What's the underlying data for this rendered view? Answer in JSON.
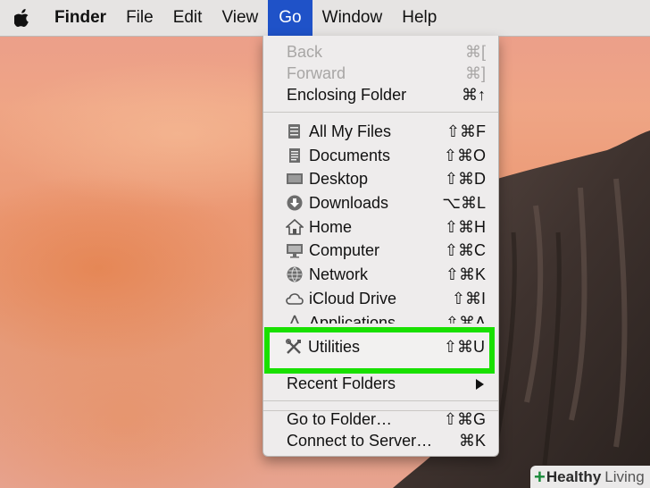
{
  "menubar": {
    "apple_icon": "apple-icon",
    "items": [
      {
        "label": "Finder"
      },
      {
        "label": "File"
      },
      {
        "label": "Edit"
      },
      {
        "label": "View"
      },
      {
        "label": "Go"
      },
      {
        "label": "Window"
      },
      {
        "label": "Help"
      }
    ]
  },
  "go_menu": {
    "nav": [
      {
        "label": "Back",
        "shortcut": "⌘[",
        "enabled": false
      },
      {
        "label": "Forward",
        "shortcut": "⌘]",
        "enabled": false
      },
      {
        "label": "Enclosing Folder",
        "shortcut": "⌘↑",
        "enabled": true
      }
    ],
    "places": [
      {
        "label": "All My Files",
        "shortcut": "⇧⌘F",
        "icon": "all-files-icon"
      },
      {
        "label": "Documents",
        "shortcut": "⇧⌘O",
        "icon": "documents-icon"
      },
      {
        "label": "Desktop",
        "shortcut": "⇧⌘D",
        "icon": "desktop-icon"
      },
      {
        "label": "Downloads",
        "shortcut": "⌥⌘L",
        "icon": "downloads-icon"
      },
      {
        "label": "Home",
        "shortcut": "⇧⌘H",
        "icon": "home-icon"
      },
      {
        "label": "Computer",
        "shortcut": "⇧⌘C",
        "icon": "computer-icon"
      },
      {
        "label": "Network",
        "shortcut": "⇧⌘K",
        "icon": "network-icon"
      },
      {
        "label": "iCloud Drive",
        "shortcut": "⇧⌘I",
        "icon": "cloud-icon"
      },
      {
        "label": "Applications",
        "shortcut": "⇧⌘A",
        "icon": "applications-icon"
      },
      {
        "label": "Utilities",
        "shortcut": "⇧⌘U",
        "icon": "utilities-icon"
      }
    ],
    "recent": {
      "label": "Recent Folders"
    },
    "folder": [
      {
        "label": "Go to Folder…",
        "shortcut": "⇧⌘G"
      },
      {
        "label": "Connect to Server…",
        "shortcut": "⌘K"
      }
    ],
    "highlight_color": "#19e000"
  },
  "watermark": {
    "word1": "Healthy",
    "word2": "Living"
  }
}
